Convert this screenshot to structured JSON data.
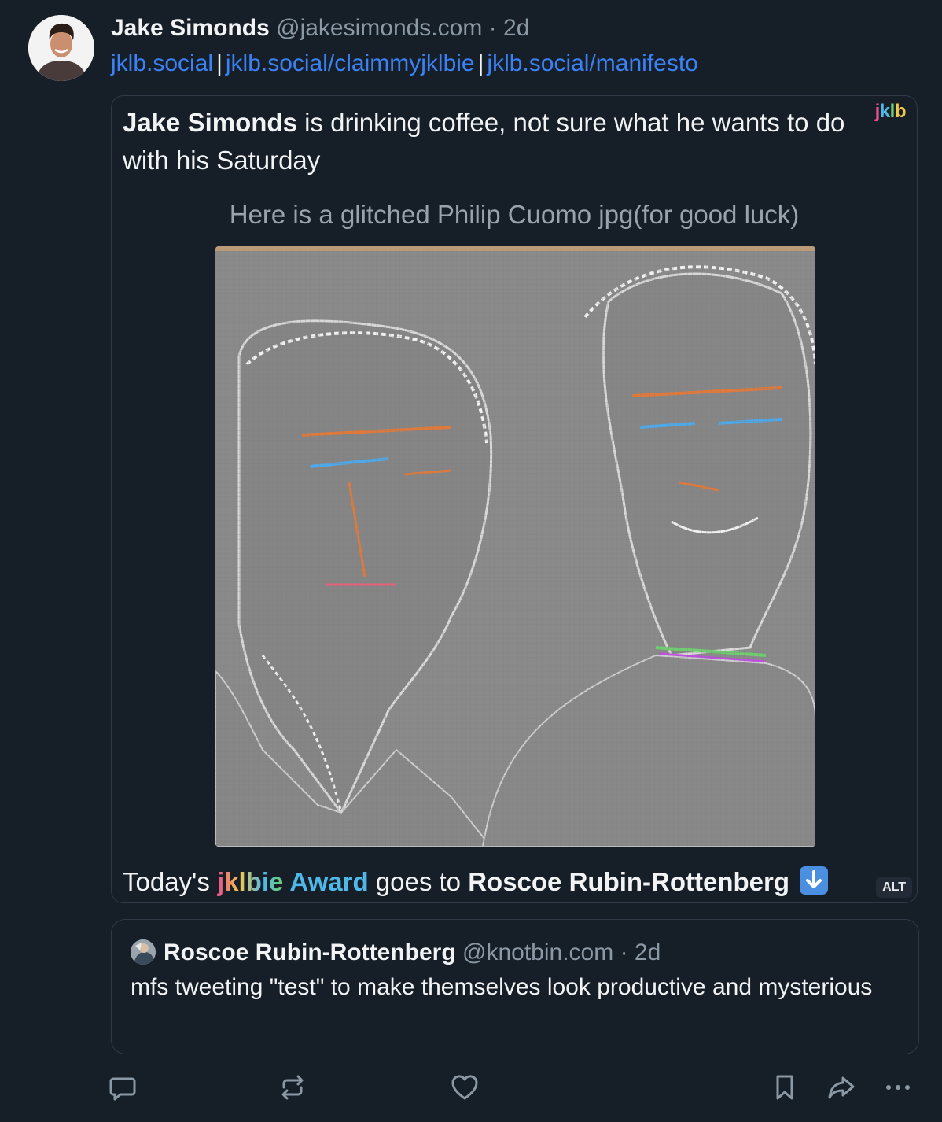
{
  "author": {
    "name": "Jake Simonds",
    "handle": "@jakesimonds.com",
    "separator": "·",
    "time": "2d"
  },
  "links": [
    "jklb.social",
    "jklb.social/claimmyjklbie",
    "jklb.social/manifesto"
  ],
  "link_separator": "|",
  "embed": {
    "status_name": "Jake Simonds",
    "status_text": " is drinking coffee, not sure what he wants to do with his Saturday",
    "logo_letters": [
      "j",
      "k",
      "l",
      "b"
    ],
    "logo_colors": [
      "#e94f8a",
      "#4fb8e8",
      "#6fcf6f",
      "#f2c94c"
    ],
    "image_caption": "Here is a glitched Philip Cuomo jpg(for good luck)",
    "award_prefix": "Today's ",
    "award_jklbie": "jklbie",
    "award_word": " Award",
    "award_middle": " goes to ",
    "award_recipient": "Roscoe Rubin-Rottenberg",
    "alt_label": "ALT"
  },
  "quote": {
    "name": "Roscoe Rubin-Rottenberg",
    "handle": "@knotbin.com",
    "separator": "·",
    "time": "2d",
    "text": "mfs tweeting \"test\" to make themselves look productive and mysterious"
  },
  "actions": {
    "icons": [
      "reply-icon",
      "repost-icon",
      "like-icon",
      "bookmark-icon",
      "share-icon",
      "more-icon"
    ]
  },
  "colors": {
    "background": "#161e27",
    "link": "#3b82f6",
    "muted": "#8b98a5",
    "border": "#2e3a48"
  }
}
